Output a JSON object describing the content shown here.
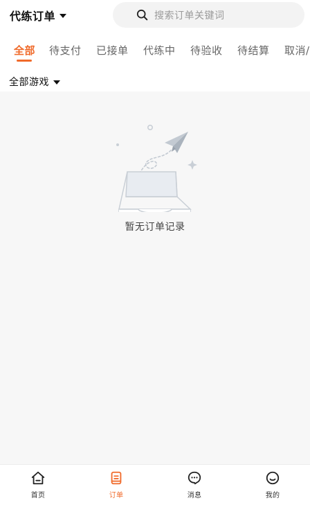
{
  "header": {
    "title": "代练订单",
    "search_placeholder": "搜索订单关键词"
  },
  "tabs": [
    {
      "label": "全部",
      "active": true
    },
    {
      "label": "待支付",
      "active": false
    },
    {
      "label": "已接单",
      "active": false
    },
    {
      "label": "代练中",
      "active": false
    },
    {
      "label": "待验收",
      "active": false
    },
    {
      "label": "待结算",
      "active": false
    },
    {
      "label": "取消/",
      "active": false
    }
  ],
  "filter": {
    "game_label": "全部游戏"
  },
  "empty_state": {
    "text": "暂无订单记录",
    "icon": "empty-box-paper-plane-icon"
  },
  "tabbar": [
    {
      "label": "首页",
      "icon": "home-icon",
      "active": false
    },
    {
      "label": "订单",
      "icon": "order-icon",
      "active": true
    },
    {
      "label": "消息",
      "icon": "message-icon",
      "active": false
    },
    {
      "label": "我的",
      "icon": "profile-icon",
      "active": false
    }
  ],
  "colors": {
    "accent": "#f06a2a",
    "page_bg": "#f7f7f7",
    "surface": "#ffffff"
  }
}
